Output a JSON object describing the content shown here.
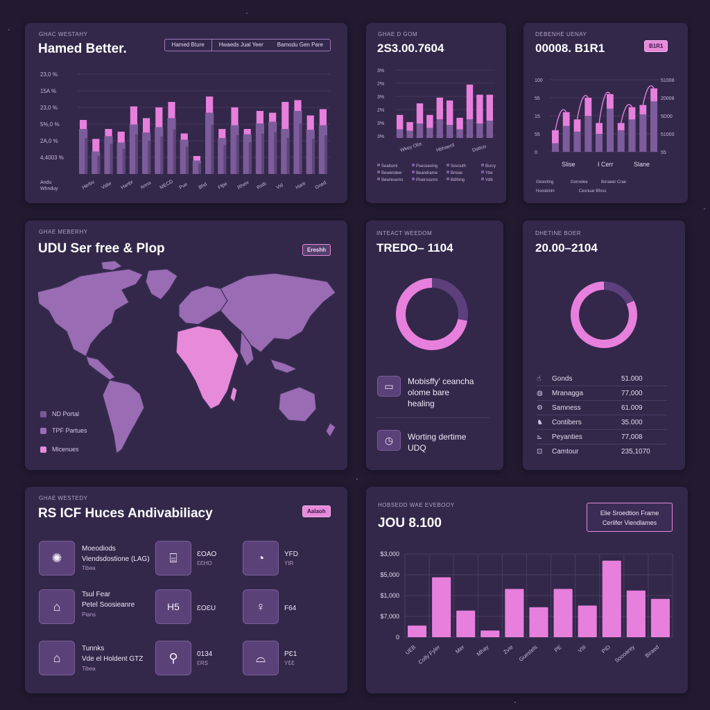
{
  "colors": {
    "background": "#211a31",
    "card": "#33284a",
    "accent_pink": "#e77fdc",
    "accent_purple": "#7d5c9b"
  },
  "panel1": {
    "kicker": "GHAC WESTAHY",
    "title": "Hamed Better.",
    "tabs": [
      "Hamed Bture",
      "Hwaeds Jual Yeer",
      "Bamodu Gen Pare"
    ],
    "y_ticks": [
      "23,0 %",
      "15A %",
      "23,0 %",
      "5%,0 %",
      "2A,0 %",
      "4,4003 %"
    ],
    "y_footer": "Andu\nWhnduy",
    "x_labels": [
      "Herbu",
      "Vidw",
      "Hanbr",
      "Anna",
      "MECD",
      "Pue",
      "Bhd",
      "Ffpe",
      "Rheiv",
      "Rstb",
      "Vid",
      "Hare",
      "Gned"
    ]
  },
  "panel2": {
    "kicker": "GHAE D GOM",
    "title": "2S3.00.7604",
    "y_ticks": [
      "3%",
      "2%",
      "3%",
      "2%",
      "3%",
      "3%"
    ],
    "x_labels": [
      "Wkey Obs",
      "Hbhaerd",
      "Dattuo"
    ],
    "legend": [
      [
        "Sealtuml",
        "Pseoseving",
        "Sovouth",
        "Bsrcy"
      ],
      [
        "Bewendew",
        "Beandrame",
        "Bmiae",
        "Ybe"
      ],
      [
        "Bewresems",
        "Ploerssums",
        "Bdlhing",
        "Vdb"
      ]
    ]
  },
  "panel3": {
    "kicker": "DEBENHE UENAY",
    "title": "00008. B1R1",
    "pill": "B1R1",
    "y_ticks_left": [
      "100",
      "55",
      "15",
      "55",
      "0"
    ],
    "y_ticks_right": [
      "51008",
      "20008",
      "5D00",
      "51000",
      "55"
    ],
    "x_labels": [
      "Slise",
      "I Cerr",
      "Slane"
    ],
    "legend": [
      "Gloevting",
      "Gonrelee",
      "Boraeer Crae",
      "Hoosbinin",
      "Cesnuar Bfoss"
    ]
  },
  "panel4": {
    "kicker": "GHAE MEBERHY",
    "title": "UDU Ser free & Plop",
    "pill": "Ereshh",
    "legend": [
      {
        "label": "ND Portal",
        "color": "#7a5a96"
      },
      {
        "label": "TPF Partues",
        "color": "#9a6cb3"
      },
      {
        "label": "Mlcenues",
        "color": "#e68ad9"
      }
    ]
  },
  "panel5": {
    "kicker": "INTEACT WEEDOM",
    "title": "TREDO– 1104",
    "donut_fraction": 0.72,
    "rows": [
      {
        "icon": "screen-icon",
        "text": "Mobisffy' ceancha\nolome bare\nhealing"
      },
      {
        "icon": "clock-icon",
        "text": "Worting dertime\nUDQ"
      }
    ]
  },
  "panel6": {
    "kicker": "DHETINE BOER",
    "title": "20.00–2104",
    "donut_fraction": 0.82,
    "rows": [
      {
        "icon": "hand-icon",
        "label": "Gonds",
        "value": "51.000"
      },
      {
        "icon": "globe-icon",
        "label": "Mranagga",
        "value": "77,000"
      },
      {
        "icon": "gear-icon",
        "label": "Samness",
        "value": "61.009"
      },
      {
        "icon": "run-icon",
        "label": "Contibers",
        "value": "35.000"
      },
      {
        "icon": "chart-icon",
        "label": "Peyanties",
        "value": "77,008"
      },
      {
        "icon": "lock-icon",
        "label": "Camtour",
        "value": "235,1070"
      }
    ]
  },
  "panel7": {
    "kicker": "GHAE WESTEDY",
    "title": "RS ICF Huces Andivabiliacy",
    "pill": "Aalaoh",
    "items": [
      {
        "icon": "sun-icon",
        "label": "Moeodiods\nViendsdostione (LAG)",
        "sub": "Tibea"
      },
      {
        "icon": "camera-icon",
        "label": "ƐOAO",
        "sub": "ƐƐHO"
      },
      {
        "icon": "gauge-icon",
        "label": "YFD",
        "sub": "YIR"
      },
      {
        "icon": "house-icon",
        "label": "Tsul Fear\nPetel Soosieanre",
        "sub": "Pians"
      },
      {
        "icon": "h5-icon",
        "label": "ƐOƐU",
        "sub": ""
      },
      {
        "icon": "mic-icon",
        "label": "F64",
        "sub": ""
      },
      {
        "icon": "barn-icon",
        "label": "Tunnks\nVde el Holdent GTZ",
        "sub": "Tibea"
      },
      {
        "icon": "tool-icon",
        "label": "0134",
        "sub": "ƐRS"
      },
      {
        "icon": "boat-icon",
        "label": "PƐ1",
        "sub": "YƐƐ"
      }
    ]
  },
  "panel8": {
    "kicker": "HOBSEDD WAE EVEBOOY",
    "title": "JOU 8.100",
    "pill_lines": [
      "Elie Sroedtion Frame",
      "Cerlifer Viendlames"
    ],
    "y_ticks": [
      "$3,000",
      "$5,000",
      "$1,000",
      "$7,000",
      "0"
    ],
    "x_labels": [
      "UEB",
      "Colly Fyler",
      "Mer",
      "Mhay",
      "Zvie",
      "Guestels",
      "PE",
      "VIII",
      "PID",
      "Soooarey",
      "Biraed"
    ]
  },
  "chart_data": [
    {
      "type": "bar",
      "title": "Hamed Better.",
      "series": [
        {
          "values": [
            50,
            25,
            42,
            35,
            55,
            46,
            52,
            62,
            38,
            15,
            68,
            40,
            54,
            44,
            56,
            58,
            50,
            70,
            49,
            54
          ]
        },
        {
          "values": [
            10,
            14,
            8,
            12,
            20,
            16,
            22,
            18,
            7,
            5,
            18,
            10,
            20,
            6,
            14,
            10,
            30,
            12,
            16,
            18
          ]
        }
      ],
      "ylim": [
        0,
        100
      ]
    },
    {
      "type": "bar",
      "title": "2S3.00.7604",
      "series": [
        {
          "values": [
            20,
            12,
            28,
            18,
            30,
            34,
            16,
            48,
            40,
            36
          ]
        },
        {
          "values": [
            12,
            10,
            20,
            14,
            26,
            18,
            12,
            26,
            20,
            24
          ]
        }
      ],
      "ylim": [
        0,
        100
      ]
    },
    {
      "type": "bar",
      "title": "00008. B1R1",
      "series": [
        {
          "values": [
            30,
            55,
            45,
            75,
            40,
            80,
            40,
            62,
            65,
            88
          ]
        },
        {
          "values": [
            12,
            36,
            28,
            50,
            25,
            60,
            30,
            45,
            52,
            70
          ]
        }
      ],
      "ylim": [
        0,
        100
      ]
    },
    {
      "type": "pie",
      "title": "TREDO– 1104",
      "values": [
        72,
        28
      ]
    },
    {
      "type": "pie",
      "title": "20.00–2104",
      "values": [
        82,
        18
      ]
    },
    {
      "type": "bar",
      "title": "JOU 8.100",
      "categories": [
        "UEB",
        "Colly Fyler",
        "Mer",
        "Mhay",
        "Zvie",
        "Guestels",
        "PE",
        "VIII",
        "PID",
        "Soooarey",
        "Biraed"
      ],
      "values": [
        700,
        3600,
        1600,
        400,
        2900,
        1800,
        2900,
        1900,
        4600,
        2800,
        2300
      ],
      "ylim": [
        0,
        5000
      ]
    }
  ]
}
